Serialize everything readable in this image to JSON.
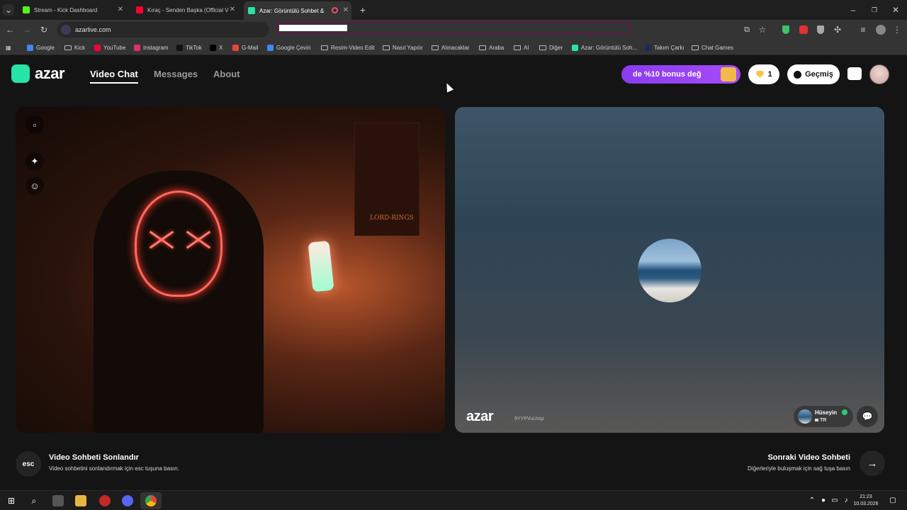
{
  "browser": {
    "tabs": [
      {
        "title": "Stream - Kick Dashboard",
        "fav_color": "#53fc18",
        "active": false
      },
      {
        "title": "Kıraç - Senden Başka (Official V",
        "fav_color": "#ff0033",
        "active": false
      },
      {
        "title": "Azar: Görüntülü Sohbet & ",
        "fav_color": "#27e3a7",
        "active": true
      }
    ],
    "new_tab": "+",
    "url": "azarlive.com",
    "bookmarks": [
      {
        "label": "Google",
        "type": "site",
        "color": "#4285f4"
      },
      {
        "label": "Kick",
        "type": "folder"
      },
      {
        "label": "YouTube",
        "type": "site",
        "color": "#ff0033"
      },
      {
        "label": "Instagram",
        "type": "site",
        "color": "#e1306c"
      },
      {
        "label": "TikTok",
        "type": "site",
        "color": "#111111"
      },
      {
        "label": "X",
        "type": "site",
        "color": "#000000"
      },
      {
        "label": "G-Mail",
        "type": "site",
        "color": "#ea4335"
      },
      {
        "label": "Google Çeviri",
        "type": "site",
        "color": "#4285f4"
      },
      {
        "label": "Resim-Video Edit",
        "type": "folder"
      },
      {
        "label": "Nasıl Yapılır",
        "type": "folder"
      },
      {
        "label": "Alınacaklar",
        "type": "folder"
      },
      {
        "label": "Araba",
        "type": "folder"
      },
      {
        "label": "AI",
        "type": "folder"
      },
      {
        "label": "Diğer",
        "type": "folder"
      },
      {
        "label": "Azar: Görüntülü Soh...",
        "type": "site",
        "color": "#27e3a7"
      },
      {
        "label": "Takım Çarkı",
        "type": "site",
        "color": "#1e2a5a"
      },
      {
        "label": "Chat Games",
        "type": "folder"
      }
    ]
  },
  "app": {
    "logo": "azar",
    "nav": {
      "video_chat": "Video Chat",
      "messages": "Messages",
      "about": "About"
    },
    "bonus_banner": "de %10 bonus değ",
    "gem_count": "1",
    "history_label": "Geçmiş",
    "peer": {
      "watermark": "azar",
      "watermark_id": "9YYPVuUxqz",
      "name": "Hüseyin",
      "country": "TR"
    },
    "poster_text": "LORD·RINGS",
    "shortcuts": {
      "esc_key": "esc",
      "end_title": "Video Sohbeti Sonlandır",
      "end_sub": "Video sohbetini sonlandırmak için esc tuşuna basın.",
      "next_title": "Sonraki Video Sohbeti",
      "next_sub": "Diğerleriyle buluşmak için sağ tuşa basın"
    }
  },
  "taskbar": {
    "time": "21:23",
    "date": "10.03.2026"
  },
  "colors": {
    "accent": "#27e3a7",
    "bonus": "#8a3cf0",
    "page_bg": "#141414"
  }
}
